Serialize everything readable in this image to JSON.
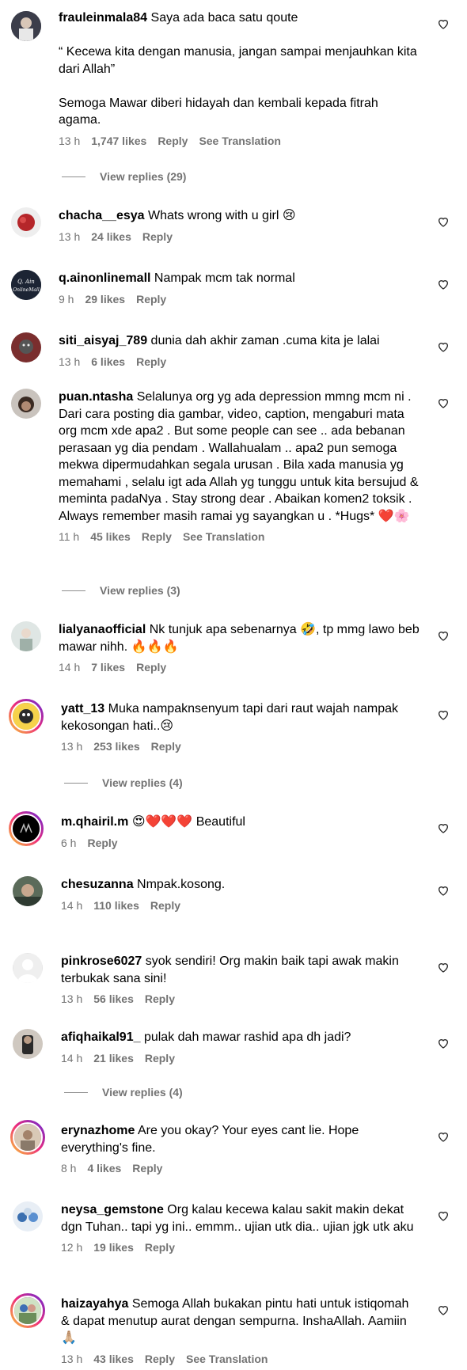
{
  "comments": [
    {
      "username": "frauleinmala84",
      "text": "Saya ada baca satu qoute\n\n“ Kecewa kita dengan manusia, jangan sampai menjauhkan kita dari Allah”\n\nSemoga Mawar diberi hidayah dan kembali kepada fitrah agama.",
      "time": "13 h",
      "likes": "1,747 likes",
      "reply": "Reply",
      "translate": "See Translation"
    },
    {
      "username": "chacha__esya",
      "text": "Whats wrong with u girl 😢",
      "time": "13 h",
      "likes": "24 likes",
      "reply": "Reply"
    },
    {
      "username": "q.ainonlinemall",
      "text": "Nampak mcm tak normal",
      "time": "9 h",
      "likes": "29 likes",
      "reply": "Reply"
    },
    {
      "username": "siti_aisyaj_789",
      "text": "dunia dah akhir zaman .cuma kita je lalai",
      "time": "13 h",
      "likes": "6 likes",
      "reply": "Reply"
    },
    {
      "username": "puan.ntasha",
      "text": "Selalunya org yg ada depression mmng mcm ni . Dari cara posting dia gambar, video, caption, mengaburi mata org mcm xde apa2 . But some people can see .. ada bebanan perasaan yg dia pendam . Wallahualam .. apa2 pun semoga mekwa dipermudahkan segala urusan . Bila xada manusia yg memahami , selalu igt ada Allah yg tunggu untuk kita bersujud & meminta padaNya . Stay strong dear . Abaikan komen2 toksik . Always remember masih ramai yg sayangkan u . *Hugs* ❤️🌸",
      "time": "11 h",
      "likes": "45 likes",
      "reply": "Reply",
      "translate": "See Translation"
    },
    {
      "username": "lialyanaofficial",
      "text": "Nk tunjuk apa sebenarnya 🤣, tp mmg lawo beb mawar nihh. 🔥🔥🔥",
      "time": "14 h",
      "likes": "7 likes",
      "reply": "Reply"
    },
    {
      "username": "yatt_13",
      "text": "Muka nampaknsenyum tapi dari raut wajah nampak kekosongan hati..😢",
      "time": "13 h",
      "likes": "253 likes",
      "reply": "Reply"
    },
    {
      "username": "m.qhairil.m",
      "text": "😍❤️❤️❤️ Beautiful",
      "time": "6 h",
      "likes": "",
      "reply": "Reply"
    },
    {
      "username": "chesuzanna",
      "text": "Nmpak.kosong.",
      "time": "14 h",
      "likes": "110 likes",
      "reply": "Reply"
    },
    {
      "username": "pinkrose6027",
      "text": "syok sendiri! Org makin baik tapi awak makin terbukak sana sini!",
      "time": "13 h",
      "likes": "56 likes",
      "reply": "Reply"
    },
    {
      "username": "afiqhaikal91_",
      "text": "pulak dah mawar rashid apa dh jadi?",
      "time": "14 h",
      "likes": "21 likes",
      "reply": "Reply"
    },
    {
      "username": "erynazhome",
      "text": "Are you okay? Your eyes cant lie. Hope everything's fine.",
      "time": "8 h",
      "likes": "4 likes",
      "reply": "Reply"
    },
    {
      "username": "neysa_gemstone",
      "text": "Org kalau kecewa kalau sakit makin dekat dgn Tuhan.. tapi yg ini.. emmm.. ujian utk dia.. ujian jgk utk aku",
      "time": "12 h",
      "likes": "19 likes",
      "reply": "Reply"
    },
    {
      "username": "haizayahya",
      "text": "Semoga Allah bukakan pintu hati untuk istiqomah & dapat menutup aurat dengan sempurna. InshaAllah. Aamiin 🙏🏼",
      "time": "13 h",
      "likes": "43 likes",
      "reply": "Reply",
      "translate": "See Translation"
    }
  ],
  "replies": [
    "View replies (29)",
    "View replies (3)",
    "View replies (4)",
    "View replies (4)"
  ]
}
